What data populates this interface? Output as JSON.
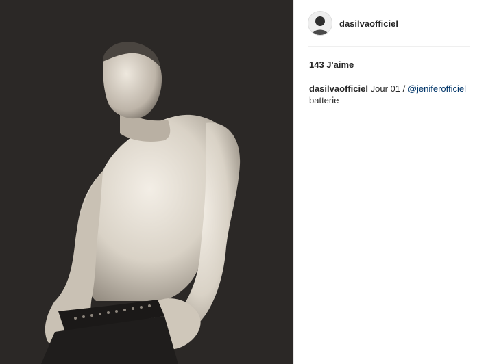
{
  "post": {
    "username": "dasilvaofficiel",
    "likes_label": "143 J'aime",
    "caption": {
      "username": "dasilvaofficiel",
      "text_before": "Jour 01 / ",
      "mention": "@jeniferofficiel",
      "text_after": "batterie"
    }
  },
  "colors": {
    "photo_background": "#2b2826",
    "mention": "#003569",
    "text": "#262626"
  }
}
